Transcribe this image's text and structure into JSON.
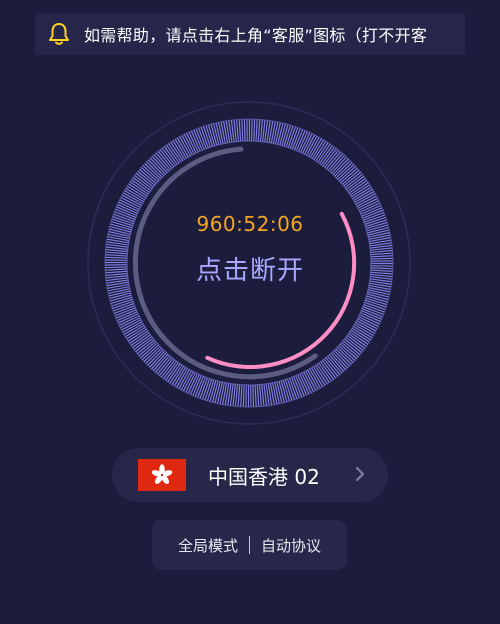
{
  "notice": {
    "icon": "bell-icon",
    "text": "如需帮助，请点击右上角“客服”图标（打不开客"
  },
  "connection": {
    "timer": "960:52:06",
    "action_label": "点击断开",
    "accent_color": "#f5a623",
    "ring_color": "#8b86f0",
    "progress_color": "#ff8ec7"
  },
  "server": {
    "flag_icon": "hong-kong-flag-icon",
    "name": "中国香港 02",
    "chevron_icon": "chevron-right-icon"
  },
  "mode": {
    "global": "全局模式",
    "protocol": "自动协议"
  }
}
